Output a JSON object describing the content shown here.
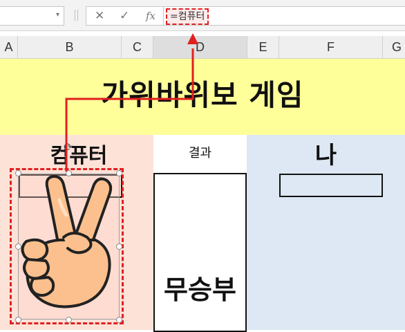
{
  "formula_bar": {
    "name_box_value": "",
    "dropdown_glyph": "▾",
    "cancel_glyph": "✕",
    "enter_glyph": "✓",
    "fx_glyph": "fx",
    "formula": "=컴퓨터"
  },
  "columns": [
    "A",
    "B",
    "C",
    "D",
    "E",
    "F",
    "G"
  ],
  "sheet": {
    "title": "가위바위보 게임",
    "computer_label": "컴퓨터",
    "result_label": "결과",
    "me_label": "나",
    "result_value": "무승부"
  },
  "picture": {
    "icon": "victory-hand-icon",
    "label": "scissors"
  },
  "colors": {
    "title_band": "#ffff99",
    "computer_bg": "#fde2d8",
    "me_bg": "#dde8f4",
    "highlight_red": "#e02020"
  }
}
